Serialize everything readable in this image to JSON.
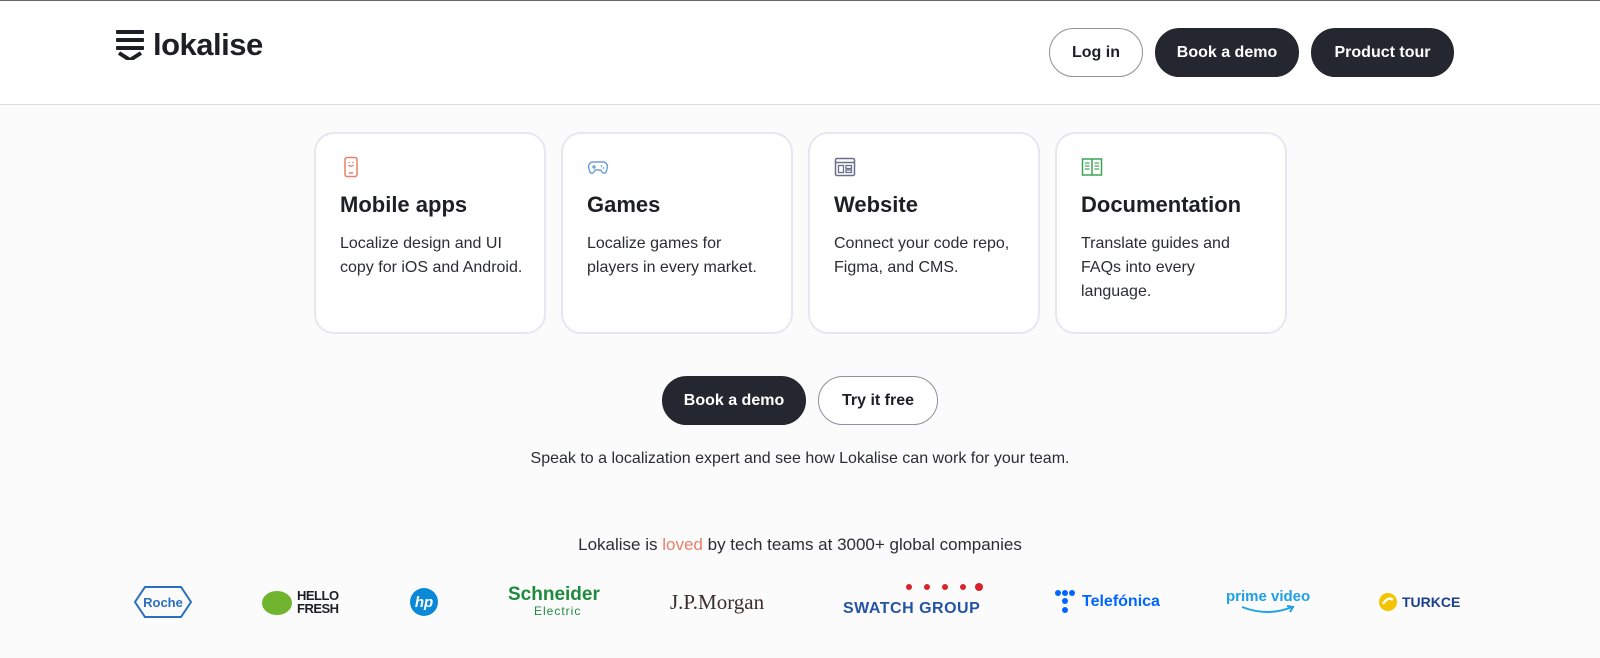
{
  "header": {
    "logo_text": "lokalise",
    "login_label": "Log in",
    "book_demo_label": "Book a demo",
    "product_tour_label": "Product tour"
  },
  "cards": [
    {
      "icon": "mobile-phone-icon",
      "icon_color": "#e8806a",
      "title": "Mobile apps",
      "text": "Localize design and UI copy for iOS and Android."
    },
    {
      "icon": "gamepad-icon",
      "icon_color": "#6a9fd8",
      "title": "Games",
      "text": "Localize games for players in every market."
    },
    {
      "icon": "browser-window-icon",
      "icon_color": "#6c6f8a",
      "title": "Website",
      "text": "Connect your code repo, Figma, and CMS."
    },
    {
      "icon": "open-book-icon",
      "icon_color": "#3aa655",
      "title": "Documentation",
      "text": "Translate guides and FAQs into every language."
    }
  ],
  "cta": {
    "book_demo_label": "Book a demo",
    "try_free_label": "Try it free",
    "note": "Speak to a localization expert and see how Lokalise can work for your team."
  },
  "loved": {
    "prefix": "Lokalise is ",
    "accent": "loved",
    "suffix": " by tech teams at 3000+ global companies",
    "accent_color": "#e8806a"
  },
  "logos": {
    "roche": "Roche",
    "hellofresh_1": "HELLO",
    "hellofresh_2": "FRESH",
    "hp": "hp",
    "schneider_1": "Schneider",
    "schneider_2": "Electric",
    "jpmorgan": "J.P.Morgan",
    "swatch": "SWATCH GROUP",
    "telefonica": "Telefónica",
    "prime": "prime video",
    "turkcell": "TURKCE"
  },
  "colors": {
    "dark_button": "#24272f",
    "page_background": "#fbfbfc"
  }
}
